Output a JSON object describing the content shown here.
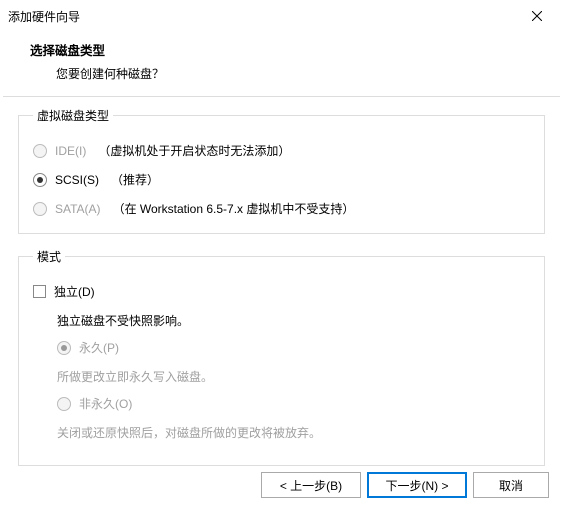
{
  "window": {
    "title": "添加硬件向导"
  },
  "header": {
    "title": "选择磁盘类型",
    "subtitle": "您要创建何种磁盘？"
  },
  "diskType": {
    "legend": "虚拟磁盘类型",
    "options": {
      "ide": {
        "label": "IDE(I)",
        "note": "（虚拟机处于开启状态时无法添加）"
      },
      "scsi": {
        "label": "SCSI(S)",
        "note": "（推荐）"
      },
      "sata": {
        "label": "SATA(A)",
        "note": "（在 Workstation 6.5-7.x 虚拟机中不受支持）"
      }
    }
  },
  "mode": {
    "legend": "模式",
    "independent": {
      "label": "独立(D)",
      "desc": "独立磁盘不受快照影响。"
    },
    "persistent": {
      "label": "永久(P)",
      "desc": "所做更改立即永久写入磁盘。"
    },
    "nonpersistent": {
      "label": "非永久(O)",
      "desc": "关闭或还原快照后，对磁盘所做的更改将被放弃。"
    }
  },
  "buttons": {
    "back": "< 上一步(B)",
    "next": "下一步(N) >",
    "cancel": "取消"
  },
  "watermark": ""
}
